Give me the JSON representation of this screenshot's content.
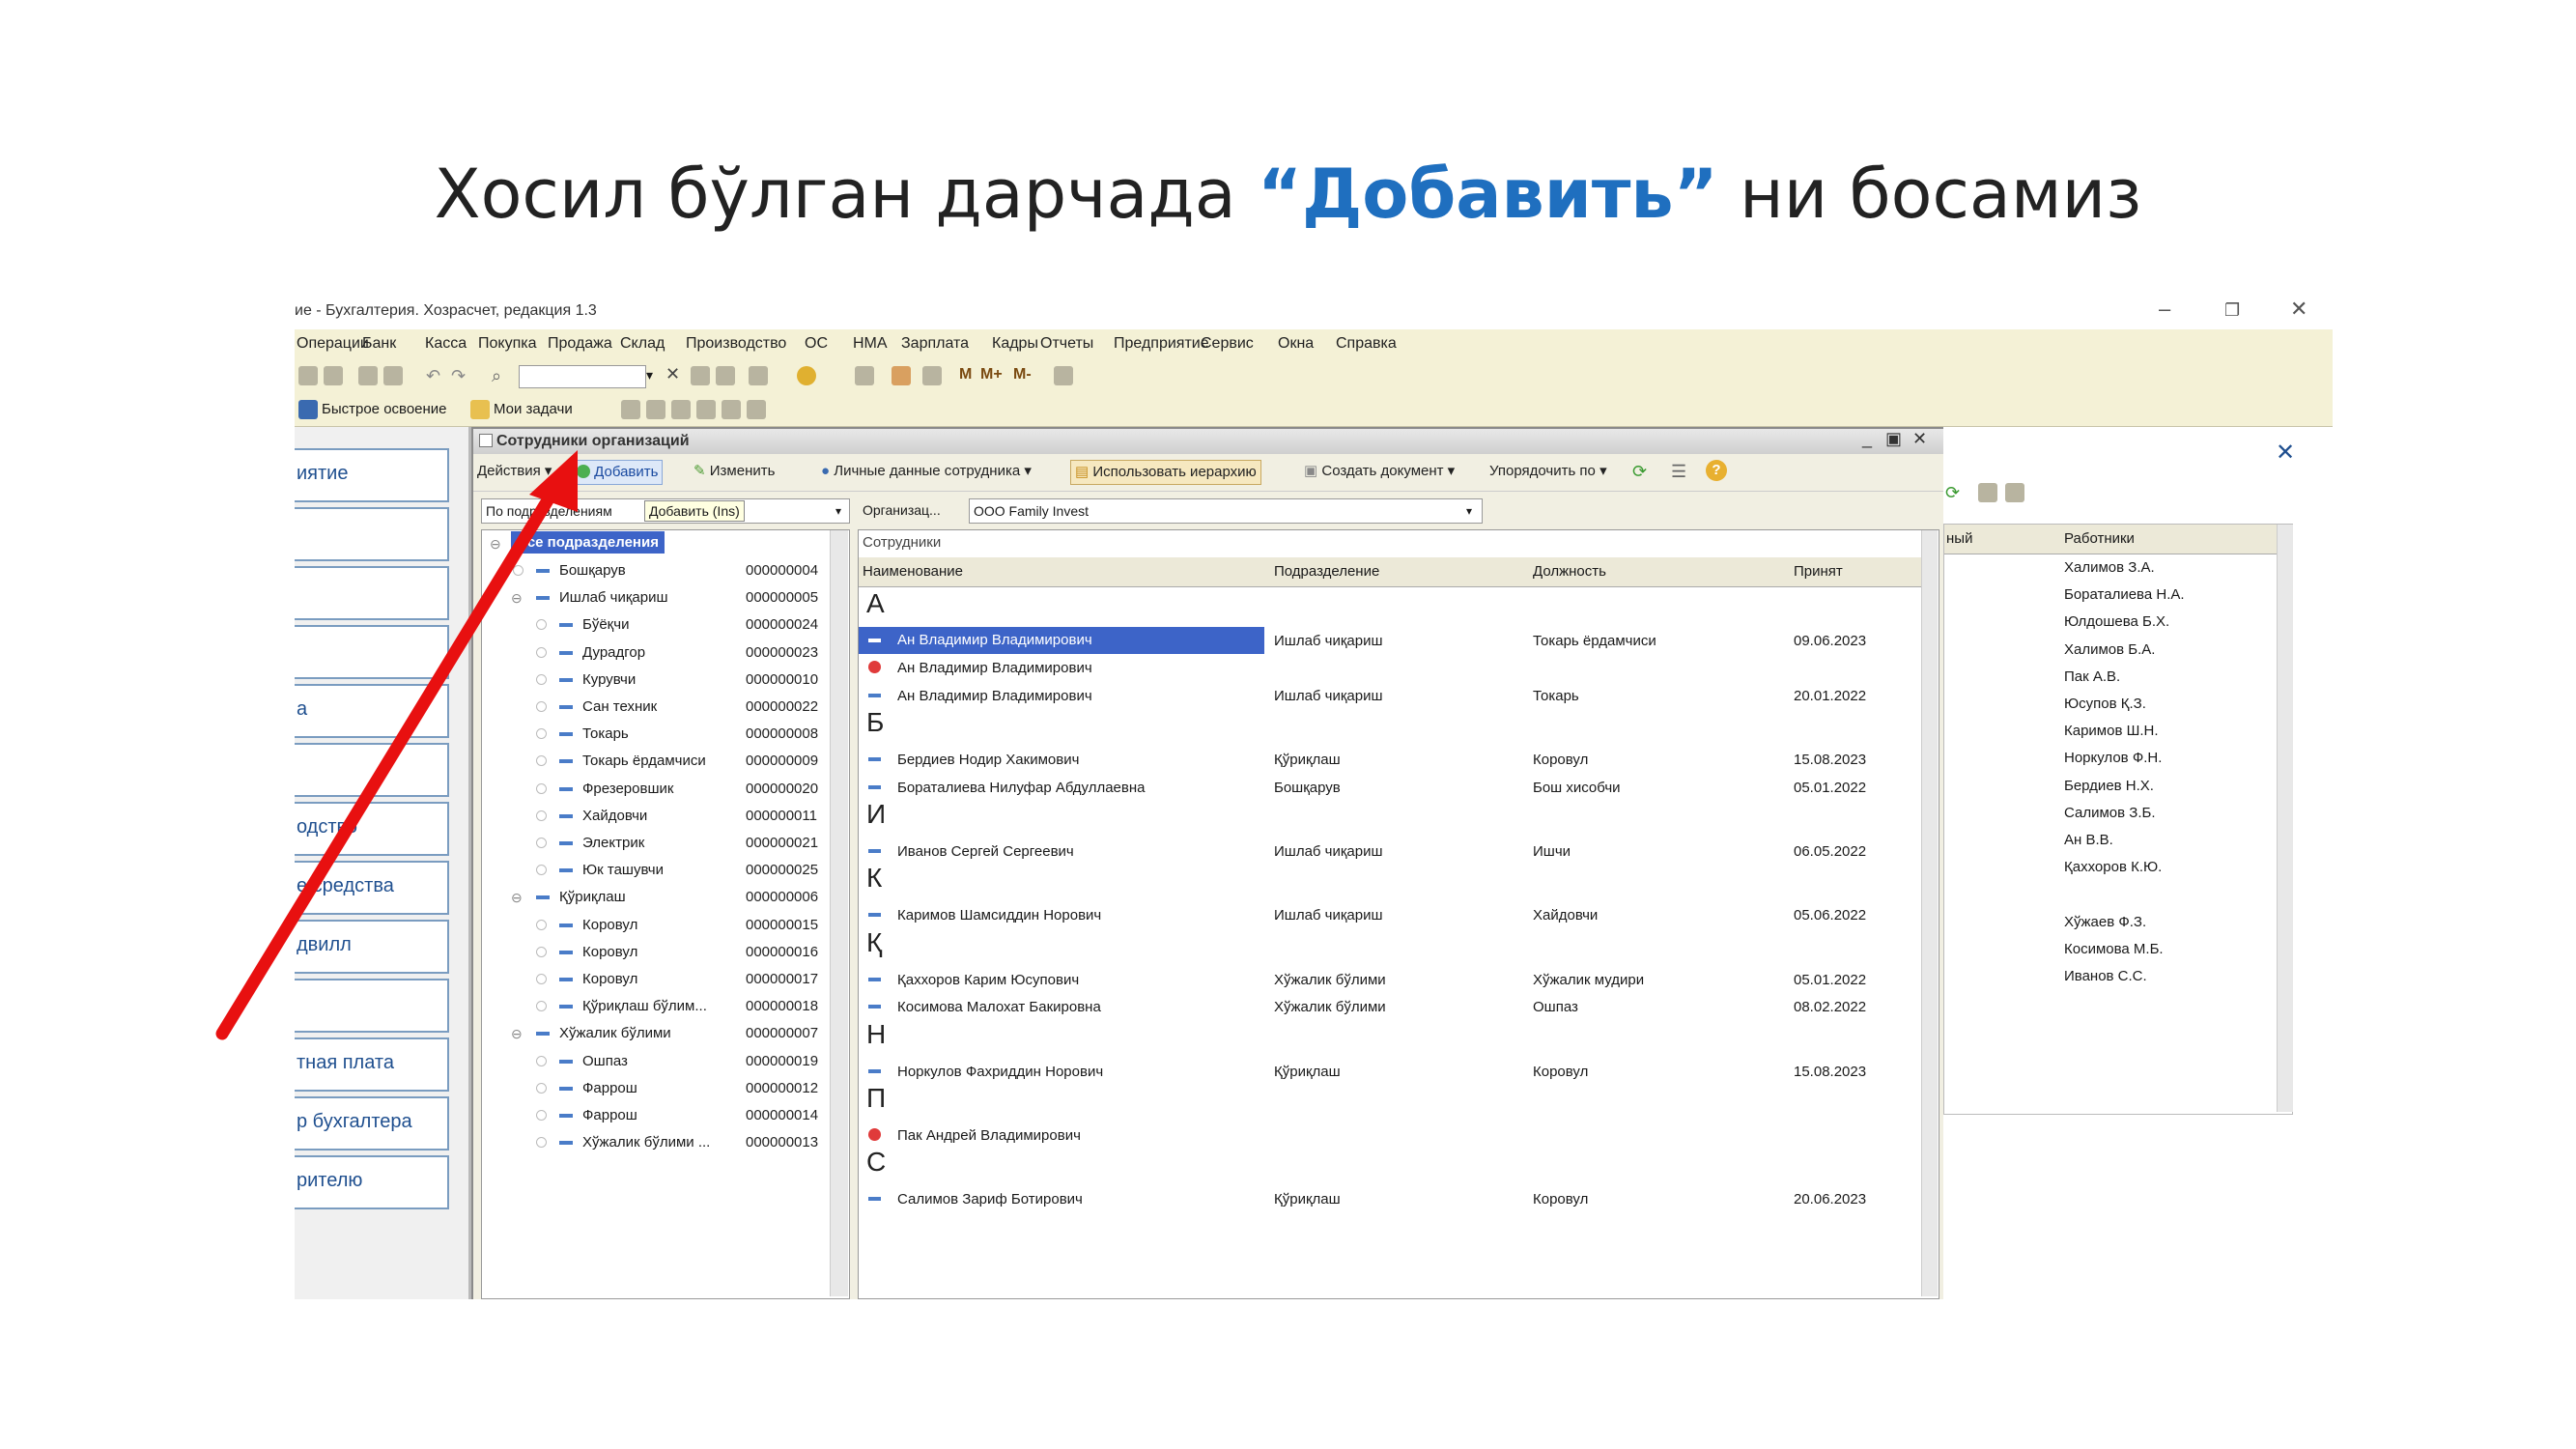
{
  "slide": {
    "title_pre": "Хосил бўлган дарчада ",
    "title_highlight": "“Добавить”",
    "title_post": " ни босамиз",
    "highlight_color": "#1f6fbf"
  },
  "window": {
    "title": "ие - Бухгалтерия. Хозрасчет, редакция 1.3",
    "menu": [
      "Операции",
      "Банк",
      "Касса",
      "Покупка",
      "Продажа",
      "Склад",
      "Производство",
      "ОС",
      "НМА",
      "Зарплата",
      "Кадры",
      "Отчеты",
      "Предприятие",
      "Сервис",
      "Окна",
      "Справка"
    ],
    "toolbar2": {
      "quick": "Быстрое освоение",
      "tasks": "Мои задачи"
    }
  },
  "sidebar": {
    "items": [
      "иятие",
      "",
      "",
      "",
      "а",
      "",
      "одство",
      "е средства",
      "двилл",
      "",
      "тная плата",
      "р бухгалтера",
      "рителю"
    ]
  },
  "employees_window": {
    "title": "Сотрудники организаций",
    "actions": {
      "actions_label": "Действия",
      "add": "Добавить",
      "edit": "Изменить",
      "personal": "Личные данные сотрудника",
      "hierarchy": "Использовать иерархию",
      "create_doc": "Создать документ",
      "sort": "Упорядочить по"
    },
    "filter": {
      "by_dept": "По подразделениям",
      "tooltip": "Добавить (Ins)",
      "org_label": "Организац...",
      "org_value": "ООО Family Invest"
    },
    "tree": {
      "root": "Все подразделения",
      "rows": [
        {
          "name": "Бошқарув",
          "code": "000000004",
          "level": 1
        },
        {
          "name": "Ишлаб чиқариш",
          "code": "000000005",
          "level": 1
        },
        {
          "name": "Бўёқчи",
          "code": "000000024",
          "level": 2
        },
        {
          "name": "Дурадгор",
          "code": "000000023",
          "level": 2
        },
        {
          "name": "Курувчи",
          "code": "000000010",
          "level": 2
        },
        {
          "name": "Сан техник",
          "code": "000000022",
          "level": 2
        },
        {
          "name": "Токарь",
          "code": "000000008",
          "level": 2
        },
        {
          "name": "Токарь ёрдамчиси",
          "code": "000000009",
          "level": 2
        },
        {
          "name": "Фрезеровшик",
          "code": "000000020",
          "level": 2
        },
        {
          "name": "Хайдовчи",
          "code": "000000011",
          "level": 2
        },
        {
          "name": "Электрик",
          "code": "000000021",
          "level": 2
        },
        {
          "name": "Юк ташувчи",
          "code": "000000025",
          "level": 2
        },
        {
          "name": "Қўриқлаш",
          "code": "000000006",
          "level": 1
        },
        {
          "name": "Коровул",
          "code": "000000015",
          "level": 2
        },
        {
          "name": "Коровул",
          "code": "000000016",
          "level": 2
        },
        {
          "name": "Коровул",
          "code": "000000017",
          "level": 2
        },
        {
          "name": "Қўриқлаш бўлим...",
          "code": "000000018",
          "level": 2
        },
        {
          "name": "Хўжалик бўлими",
          "code": "000000007",
          "level": 1
        },
        {
          "name": "Ошпаз",
          "code": "000000019",
          "level": 2
        },
        {
          "name": "Фаррош",
          "code": "000000012",
          "level": 2
        },
        {
          "name": "Фаррош",
          "code": "000000014",
          "level": 2
        },
        {
          "name": "Хўжалик бўлими ...",
          "code": "000000013",
          "level": 2
        }
      ]
    },
    "grid": {
      "label": "Сотрудники",
      "headers": [
        "Наименование",
        "Подразделение",
        "Должность",
        "Принят"
      ],
      "groups": [
        {
          "letter": "А",
          "rows": [
            {
              "name": "Ан Владимир Владимирович",
              "dept": "Ишлаб чиқариш",
              "pos": "Токарь ёрдамчиси",
              "date": "09.06.2023",
              "selected": true,
              "icon": "dash"
            },
            {
              "name": "Ан Владимир Владимирович",
              "dept": "",
              "pos": "",
              "date": "",
              "icon": "red"
            },
            {
              "name": "Ан Владимир Владимирович",
              "dept": "Ишлаб чиқариш",
              "pos": "Токарь",
              "date": "20.01.2022",
              "icon": "dash"
            }
          ]
        },
        {
          "letter": "Б",
          "rows": [
            {
              "name": "Бердиев Нодир Хакимович",
              "dept": "Қўриқлаш",
              "pos": "Коровул",
              "date": "15.08.2023",
              "icon": "dash"
            },
            {
              "name": "Бораталиева Нилуфар Абдуллаевна",
              "dept": "Бошқарув",
              "pos": "Бош хисобчи",
              "date": "05.01.2022",
              "icon": "dash"
            }
          ]
        },
        {
          "letter": "И",
          "rows": [
            {
              "name": "Иванов Сергей Сергеевич",
              "dept": "Ишлаб чиқариш",
              "pos": "Ишчи",
              "date": "06.05.2022",
              "icon": "dash"
            }
          ]
        },
        {
          "letter": "К",
          "rows": [
            {
              "name": "Каримов Шамсиддин Норович",
              "dept": "Ишлаб чиқариш",
              "pos": "Хайдовчи",
              "date": "05.06.2022",
              "icon": "dash"
            }
          ]
        },
        {
          "letter": "Қ",
          "rows": [
            {
              "name": "Қаххоров Карим Юсупович",
              "dept": "Хўжалик бўлими",
              "pos": "Хўжалик мудири",
              "date": "05.01.2022",
              "icon": "dash"
            },
            {
              "name": "Косимова Малохат Бакировна",
              "dept": "Хўжалик бўлими",
              "pos": "Ошпаз",
              "date": "08.02.2022",
              "icon": "dash"
            }
          ]
        },
        {
          "letter": "Н",
          "rows": [
            {
              "name": "Норкулов Фахриддин Норович",
              "dept": "Қўриқлаш",
              "pos": "Коровул",
              "date": "15.08.2023",
              "icon": "dash"
            }
          ]
        },
        {
          "letter": "П",
          "rows": [
            {
              "name": "Пак Андрей Владимирович",
              "dept": "",
              "pos": "",
              "date": "",
              "icon": "red"
            }
          ]
        },
        {
          "letter": "С",
          "rows": [
            {
              "name": "Салимов Зариф Ботирович",
              "dept": "Қўриқлаш",
              "pos": "Коровул",
              "date": "20.06.2023",
              "icon": "dash"
            }
          ]
        }
      ]
    }
  },
  "right_panel": {
    "col_partial": "ный",
    "col_header": "Работники",
    "workers": [
      "Халимов З.А.",
      "Бораталиева Н.А.",
      "Юлдошева Б.Х.",
      "Халимов Б.А.",
      "Пак А.В.",
      "Юсупов Қ.З.",
      "Каримов Ш.Н.",
      "Норкулов Ф.Н.",
      "Бердиев Н.Х.",
      "Салимов З.Б.",
      "Ан В.В.",
      "Қаххоров К.Ю.",
      "",
      "Хўжаев Ф.З.",
      "Косимова М.Б.",
      "Иванов С.С."
    ]
  }
}
